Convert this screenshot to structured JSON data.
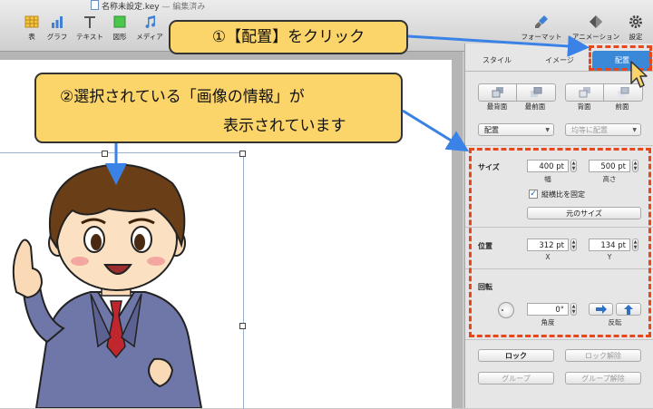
{
  "window": {
    "filename": "名称未設定.key",
    "status": " — 編集済み"
  },
  "toolbar": {
    "left_tools": [
      {
        "label": "表",
        "icon": "table-icon"
      },
      {
        "label": "グラフ",
        "icon": "chart-icon"
      },
      {
        "label": "テキスト",
        "icon": "text-icon"
      },
      {
        "label": "図形",
        "icon": "shape-icon"
      },
      {
        "label": "メディア",
        "icon": "media-icon"
      }
    ],
    "right_tools": [
      {
        "label": "フォーマット",
        "icon": "format-brush-icon"
      },
      {
        "label": "アニメーション",
        "icon": "animation-diamond-icon"
      },
      {
        "label": "設定",
        "icon": "gear-icon"
      }
    ]
  },
  "callouts": {
    "c1": "①【配置】をクリック",
    "c2_line1": "②選択されている「画像の情報」が",
    "c2_line2": "表示されています"
  },
  "inspector": {
    "tabs": [
      {
        "label": "スタイル",
        "active": false
      },
      {
        "label": "イメージ",
        "active": false
      },
      {
        "label": "配置",
        "active": true
      }
    ],
    "arrange_buttons": [
      "最背面",
      "最前面",
      "背面",
      "前面"
    ],
    "align_popup": "配置",
    "distribute_popup": "均等に配置",
    "size": {
      "label": "サイズ",
      "width": "400 pt",
      "height": "500 pt",
      "width_label": "幅",
      "height_label": "高さ",
      "constrain_label": "縦横比を固定",
      "constrain_checked": true,
      "original_size_button": "元のサイズ"
    },
    "position": {
      "label": "位置",
      "x": "312 pt",
      "y": "134 pt",
      "x_label": "X",
      "y_label": "Y"
    },
    "rotate": {
      "label": "回転",
      "angle": "0°",
      "angle_label": "角度",
      "flip_label": "反転"
    },
    "lock_button": "ロック",
    "unlock_button": "ロック解除",
    "group_button": "グループ",
    "ungroup_button": "グループ解除"
  },
  "colors": {
    "accent": "#3a88d8",
    "callout_fill": "#fbd46a",
    "dashed_outline": "#e8461b",
    "arrow": "#3b82e6"
  }
}
